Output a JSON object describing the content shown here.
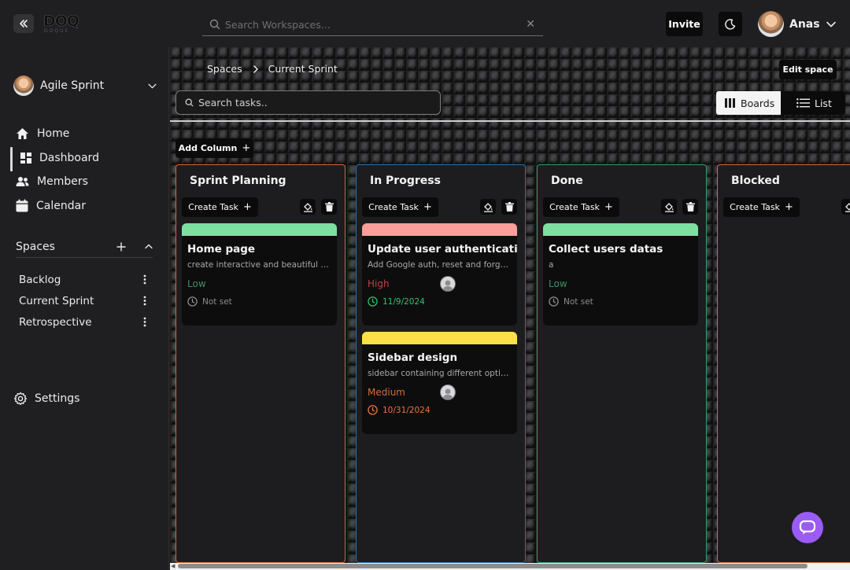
{
  "app": {
    "logo_text": "DOQ",
    "logo_subtext": "DOQUE"
  },
  "header": {
    "search_placeholder": "Search Workspaces...",
    "invite_label": "Invite",
    "user_name": "Anas"
  },
  "sidebar": {
    "workspace_name": "Agile Sprint",
    "nav": [
      {
        "label": "Home",
        "icon": "home-icon"
      },
      {
        "label": "Dashboard",
        "icon": "dashboard-icon",
        "active": true
      },
      {
        "label": "Members",
        "icon": "members-icon"
      },
      {
        "label": "Calendar",
        "icon": "calendar-icon"
      }
    ],
    "spaces_label": "Spaces",
    "spaces": [
      {
        "label": "Backlog"
      },
      {
        "label": "Current Sprint"
      },
      {
        "label": "Retrospective"
      }
    ],
    "settings_label": "Settings"
  },
  "main": {
    "breadcrumb": [
      "Spaces",
      "Current Sprint"
    ],
    "edit_space_label": "Edit space",
    "task_search_placeholder": "Search tasks..",
    "view_boards_label": "Boards",
    "view_list_label": "List",
    "add_column_label": "Add Column",
    "create_task_label": "Create Task",
    "columns": [
      {
        "title": "Sprint Planning",
        "border_color": "#d9633f",
        "tasks": [
          {
            "title": "Home page",
            "description": "create interactive and beautiful ho...",
            "priority": "Low",
            "priority_color": "#3f8f63",
            "bar_color": "#7ee0a0",
            "due": "Not set",
            "due_color": "#8d8d90",
            "has_assignee": false
          }
        ]
      },
      {
        "title": "In Progress",
        "border_color": "#2c6fa8",
        "tasks": [
          {
            "title": "Update user authentication",
            "description": "Add Google auth, reset and forgot ...",
            "priority": "High",
            "priority_color": "#c0423f",
            "bar_color": "#fb9d98",
            "due": "11/9/2024",
            "due_color": "#2ec46b",
            "has_assignee": true
          },
          {
            "title": "Sidebar design",
            "description": "sidebar containing different option...",
            "priority": "Medium",
            "priority_color": "#d86a35",
            "bar_color": "#fde047",
            "due": "10/31/2024",
            "due_color": "#e9743a",
            "has_assignee": true
          }
        ]
      },
      {
        "title": "Done",
        "border_color": "#2e9e64",
        "tasks": [
          {
            "title": "Collect users datas",
            "description": "a",
            "priority": "Low",
            "priority_color": "#3f8f63",
            "bar_color": "#7ee0a0",
            "due": "Not set",
            "due_color": "#8d8d90",
            "has_assignee": false
          }
        ]
      },
      {
        "title": "Blocked",
        "border_color": "#d9633f",
        "tasks": []
      }
    ]
  },
  "colors": {
    "accent_chat": "#9b5cf5"
  }
}
